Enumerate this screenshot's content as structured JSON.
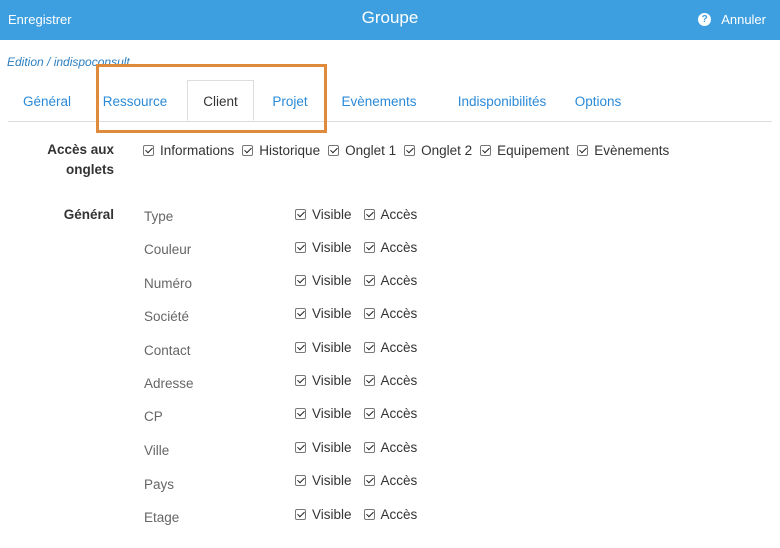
{
  "header": {
    "save_label": "Enregistrer",
    "title": "Groupe",
    "cancel_label": "Annuler"
  },
  "breadcrumb": "Edition / indispoconsult",
  "tabs": [
    {
      "label": "Général",
      "active": false
    },
    {
      "label": "Ressource",
      "active": false
    },
    {
      "label": "Client",
      "active": true
    },
    {
      "label": "Projet",
      "active": false
    },
    {
      "label": "Evènements",
      "active": false
    },
    {
      "label": "Indisponibilités",
      "active": false
    },
    {
      "label": "Options",
      "active": false
    }
  ],
  "access": {
    "label": "Accès aux onglets",
    "options": [
      {
        "label": "Informations",
        "checked": true
      },
      {
        "label": "Historique",
        "checked": true
      },
      {
        "label": "Onglet 1",
        "checked": true
      },
      {
        "label": "Onglet 2",
        "checked": true
      },
      {
        "label": "Equipement",
        "checked": true
      },
      {
        "label": "Evènements",
        "checked": true
      }
    ]
  },
  "general": {
    "label": "Général",
    "visible_label": "Visible",
    "access_label": "Accès",
    "fields": [
      {
        "name": "Type",
        "visible": true,
        "access": true
      },
      {
        "name": "Couleur",
        "visible": true,
        "access": true
      },
      {
        "name": "Numéro",
        "visible": true,
        "access": true
      },
      {
        "name": "Société",
        "visible": true,
        "access": true
      },
      {
        "name": "Contact",
        "visible": true,
        "access": true
      },
      {
        "name": "Adresse",
        "visible": true,
        "access": true
      },
      {
        "name": "CP",
        "visible": true,
        "access": true
      },
      {
        "name": "Ville",
        "visible": true,
        "access": true
      },
      {
        "name": "Pays",
        "visible": true,
        "access": true
      },
      {
        "name": "Etage",
        "visible": true,
        "access": true
      }
    ]
  },
  "colors": {
    "header_bg": "#3d9fe0",
    "link": "#2a8ad8",
    "highlight": "#e08a3b"
  }
}
